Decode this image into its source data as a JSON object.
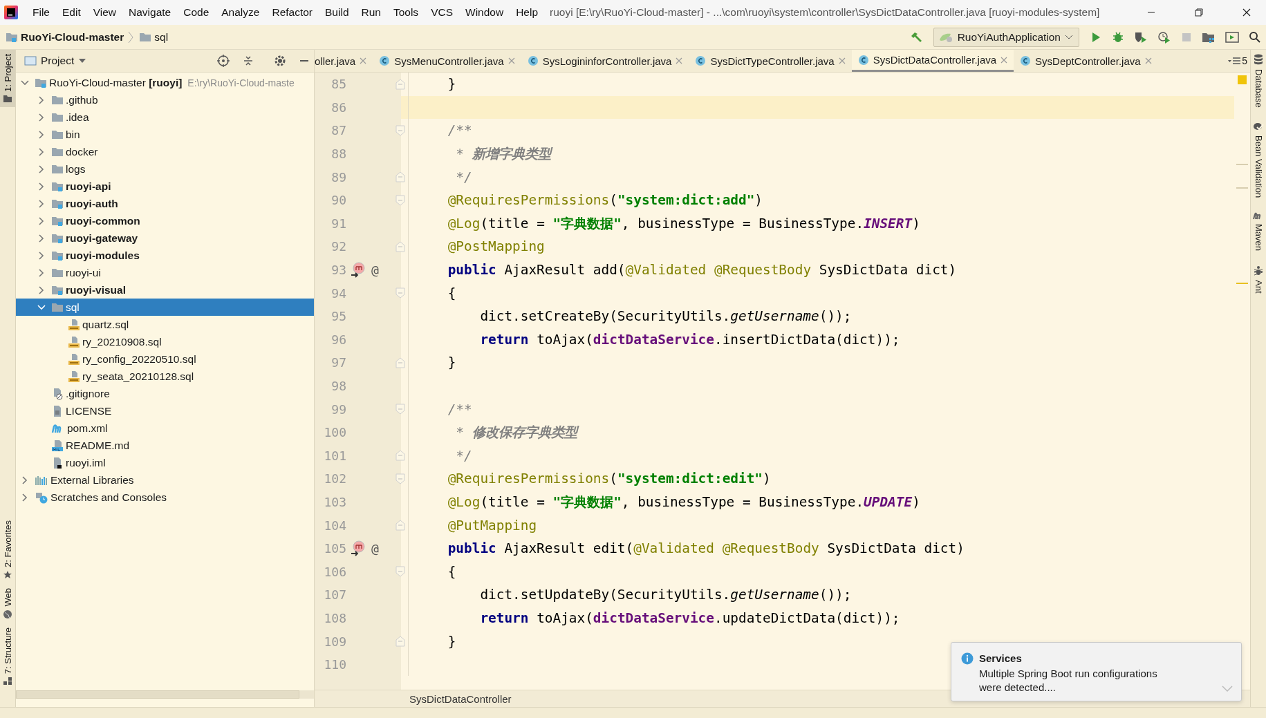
{
  "title_bar": {
    "menu": [
      "File",
      "Edit",
      "View",
      "Navigate",
      "Code",
      "Analyze",
      "Refactor",
      "Build",
      "Run",
      "Tools",
      "VCS",
      "Window",
      "Help"
    ],
    "title": "ruoyi [E:\\ry\\RuoYi-Cloud-master] - ...\\com\\ruoyi\\system\\controller\\SysDictDataController.java [ruoyi-modules-system]"
  },
  "nav_bar": {
    "breadcrumbs": [
      {
        "label": "RuoYi-Cloud-master",
        "kind": "module"
      },
      {
        "label": "sql",
        "kind": "folder"
      }
    ],
    "run_config": "RuoYiAuthApplication"
  },
  "left_strip": [
    {
      "label": "1: Project",
      "selected": true,
      "kind": "folder"
    },
    {
      "label": "2: Favorites",
      "selected": false,
      "kind": "star"
    },
    {
      "label": "Web",
      "selected": false,
      "kind": "globe"
    },
    {
      "label": "7: Structure",
      "selected": false,
      "kind": "structure"
    }
  ],
  "project_panel": {
    "title": "Project",
    "tree": [
      {
        "name": "RuoYi-Cloud-master **[ruoyi]**",
        "path": "E:\\ry\\RuoYi-Cloud-maste",
        "kind": "module",
        "expanded": true,
        "selected": false,
        "bold": false,
        "children": [
          {
            "name": ".github",
            "kind": "folder",
            "expanded": false,
            "selected": false,
            "bold": false
          },
          {
            "name": ".idea",
            "kind": "folder",
            "expanded": false,
            "selected": false,
            "bold": false
          },
          {
            "name": "bin",
            "kind": "folder",
            "expanded": false,
            "selected": false,
            "bold": false
          },
          {
            "name": "docker",
            "kind": "folder",
            "expanded": false,
            "selected": false,
            "bold": false
          },
          {
            "name": "logs",
            "kind": "folder",
            "expanded": false,
            "selected": false,
            "bold": false
          },
          {
            "name": "ruoyi-api",
            "kind": "module",
            "expanded": false,
            "selected": false,
            "bold": true
          },
          {
            "name": "ruoyi-auth",
            "kind": "module",
            "expanded": false,
            "selected": false,
            "bold": true
          },
          {
            "name": "ruoyi-common",
            "kind": "module",
            "expanded": false,
            "selected": false,
            "bold": true
          },
          {
            "name": "ruoyi-gateway",
            "kind": "module",
            "expanded": false,
            "selected": false,
            "bold": true
          },
          {
            "name": "ruoyi-modules",
            "kind": "module",
            "expanded": false,
            "selected": false,
            "bold": true
          },
          {
            "name": "ruoyi-ui",
            "kind": "folder",
            "expanded": false,
            "selected": false,
            "bold": false
          },
          {
            "name": "ruoyi-visual",
            "kind": "module",
            "expanded": false,
            "selected": false,
            "bold": true
          },
          {
            "name": "sql",
            "kind": "folder",
            "expanded": true,
            "selected": true,
            "bold": false,
            "children": [
              {
                "name": "quartz.sql",
                "kind": "sql",
                "selected": false,
                "bold": false
              },
              {
                "name": "ry_20210908.sql",
                "kind": "sql",
                "selected": false,
                "bold": false
              },
              {
                "name": "ry_config_20220510.sql",
                "kind": "sql",
                "selected": false,
                "bold": false
              },
              {
                "name": "ry_seata_20210128.sql",
                "kind": "sql",
                "selected": false,
                "bold": false
              }
            ]
          },
          {
            "name": ".gitignore",
            "kind": "ignore",
            "selected": false,
            "bold": false
          },
          {
            "name": "LICENSE",
            "kind": "text",
            "selected": false,
            "bold": false
          },
          {
            "name": "pom.xml",
            "kind": "maven",
            "selected": false,
            "bold": false
          },
          {
            "name": "README.md",
            "kind": "markdown",
            "selected": false,
            "bold": false
          },
          {
            "name": "ruoyi.iml",
            "kind": "iml",
            "selected": false,
            "bold": false
          }
        ]
      },
      {
        "name": "External Libraries",
        "kind": "libraries",
        "expanded": false,
        "selected": false,
        "bold": false
      },
      {
        "name": "Scratches and Consoles",
        "kind": "scratches",
        "expanded": false,
        "selected": false,
        "bold": false
      }
    ]
  },
  "tabs": [
    {
      "label": "oller.java",
      "kind": "cut",
      "selected": false
    },
    {
      "label": "SysMenuController.java",
      "kind": "class",
      "selected": false
    },
    {
      "label": "SysLogininforController.java",
      "kind": "class",
      "selected": false
    },
    {
      "label": "SysDictTypeController.java",
      "kind": "class",
      "selected": false
    },
    {
      "label": "SysDictDataController.java",
      "kind": "class",
      "selected": true
    },
    {
      "label": "SysDeptController.java",
      "kind": "class",
      "selected": false
    }
  ],
  "hidden_tab_count": "5",
  "editor": {
    "lines": [
      {
        "number": "85",
        "current": false,
        "fold_marker": {
          "kind": "end"
        },
        "tokens": [
          {
            "t": "    }",
            "kind": "plain"
          }
        ]
      },
      {
        "number": "86",
        "current": true
      },
      {
        "number": "87",
        "current": false,
        "fold_marker": {
          "kind": "start"
        },
        "tokens": [
          {
            "t": "    /**",
            "kind": "comment"
          }
        ]
      },
      {
        "number": "88",
        "current": false,
        "tokens": [
          {
            "t": "     * ",
            "kind": "comment"
          },
          {
            "t": "新增字典类型",
            "kind": "doc"
          }
        ]
      },
      {
        "number": "89",
        "current": false,
        "fold_marker": {
          "kind": "end"
        },
        "tokens": [
          {
            "t": "     */",
            "kind": "comment"
          }
        ]
      },
      {
        "number": "90",
        "current": false,
        "fold_marker": {
          "kind": "start"
        },
        "tokens": [
          {
            "t": "    @RequiresPermissions",
            "kind": "annotation"
          },
          {
            "t": "(",
            "kind": "plain"
          },
          {
            "t": "\"system:dict:add\"",
            "kind": "string"
          },
          {
            "t": ")",
            "kind": "plain"
          }
        ]
      },
      {
        "number": "91",
        "current": false,
        "tokens": [
          {
            "t": "    @Log",
            "kind": "annotation"
          },
          {
            "t": "(title = ",
            "kind": "plain"
          },
          {
            "t": "\"字典数据\"",
            "kind": "string"
          },
          {
            "t": ", businessType = BusinessType.",
            "kind": "plain"
          },
          {
            "t": "INSERT",
            "kind": "constant"
          },
          {
            "t": ")",
            "kind": "plain"
          }
        ]
      },
      {
        "number": "92",
        "current": false,
        "fold_marker": {
          "kind": "end"
        },
        "tokens": [
          {
            "t": "    @PostMapping",
            "kind": "annotation"
          }
        ]
      },
      {
        "number": "93",
        "current": false,
        "gutter": {
          "kind": "method",
          "symbol": "@"
        },
        "tokens": [
          {
            "t": "    public",
            "kind": "keyword"
          },
          {
            "t": " AjaxResult add(",
            "kind": "plain"
          },
          {
            "t": "@Validated @RequestBody",
            "kind": "annotation"
          },
          {
            "t": " SysDictData dict)",
            "kind": "plain"
          }
        ]
      },
      {
        "number": "94",
        "current": false,
        "fold_marker": {
          "kind": "start"
        },
        "tokens": [
          {
            "t": "    {",
            "kind": "plain"
          }
        ]
      },
      {
        "number": "95",
        "current": false,
        "tokens": [
          {
            "t": "        dict.setCreateBy(SecurityUtils.",
            "kind": "plain"
          },
          {
            "t": "getUsername",
            "kind": "static"
          },
          {
            "t": "());",
            "kind": "plain"
          }
        ]
      },
      {
        "number": "96",
        "current": false,
        "tokens": [
          {
            "t": "        return",
            "kind": "keyword"
          },
          {
            "t": " toAjax(",
            "kind": "plain"
          },
          {
            "t": "dictDataService",
            "kind": "field"
          },
          {
            "t": ".insertDictData(dict));",
            "kind": "plain"
          }
        ]
      },
      {
        "number": "97",
        "current": false,
        "fold_marker": {
          "kind": "end"
        },
        "tokens": [
          {
            "t": "    }",
            "kind": "plain"
          }
        ]
      },
      {
        "number": "98",
        "current": false
      },
      {
        "number": "99",
        "current": false,
        "fold_marker": {
          "kind": "start"
        },
        "tokens": [
          {
            "t": "    /**",
            "kind": "comment"
          }
        ]
      },
      {
        "number": "100",
        "current": false,
        "tokens": [
          {
            "t": "     * ",
            "kind": "comment"
          },
          {
            "t": "修改保存字典类型",
            "kind": "doc"
          }
        ]
      },
      {
        "number": "101",
        "current": false,
        "fold_marker": {
          "kind": "end"
        },
        "tokens": [
          {
            "t": "     */",
            "kind": "comment"
          }
        ]
      },
      {
        "number": "102",
        "current": false,
        "fold_marker": {
          "kind": "start"
        },
        "tokens": [
          {
            "t": "    @RequiresPermissions",
            "kind": "annotation"
          },
          {
            "t": "(",
            "kind": "plain"
          },
          {
            "t": "\"system:dict:edit\"",
            "kind": "string"
          },
          {
            "t": ")",
            "kind": "plain"
          }
        ]
      },
      {
        "number": "103",
        "current": false,
        "tokens": [
          {
            "t": "    @Log",
            "kind": "annotation"
          },
          {
            "t": "(title = ",
            "kind": "plain"
          },
          {
            "t": "\"字典数据\"",
            "kind": "string"
          },
          {
            "t": ", businessType = BusinessType.",
            "kind": "plain"
          },
          {
            "t": "UPDATE",
            "kind": "constant"
          },
          {
            "t": ")",
            "kind": "plain"
          }
        ]
      },
      {
        "number": "104",
        "current": false,
        "fold_marker": {
          "kind": "end"
        },
        "tokens": [
          {
            "t": "    @PutMapping",
            "kind": "annotation"
          }
        ]
      },
      {
        "number": "105",
        "current": false,
        "gutter": {
          "kind": "method",
          "symbol": "@"
        },
        "tokens": [
          {
            "t": "    public",
            "kind": "keyword"
          },
          {
            "t": " AjaxResult edit(",
            "kind": "plain"
          },
          {
            "t": "@Validated @RequestBody",
            "kind": "annotation"
          },
          {
            "t": " SysDictData dict)",
            "kind": "plain"
          }
        ]
      },
      {
        "number": "106",
        "current": false,
        "fold_marker": {
          "kind": "start"
        },
        "tokens": [
          {
            "t": "    {",
            "kind": "plain"
          }
        ]
      },
      {
        "number": "107",
        "current": false,
        "tokens": [
          {
            "t": "        dict.setUpdateBy(SecurityUtils.",
            "kind": "plain"
          },
          {
            "t": "getUsername",
            "kind": "static"
          },
          {
            "t": "());",
            "kind": "plain"
          }
        ]
      },
      {
        "number": "108",
        "current": false,
        "tokens": [
          {
            "t": "        return",
            "kind": "keyword"
          },
          {
            "t": " toAjax(",
            "kind": "plain"
          },
          {
            "t": "dictDataService",
            "kind": "field"
          },
          {
            "t": ".updateDictData(dict));",
            "kind": "plain"
          }
        ]
      },
      {
        "number": "109",
        "current": false,
        "fold_marker": {
          "kind": "end"
        },
        "tokens": [
          {
            "t": "    }",
            "kind": "plain"
          }
        ]
      },
      {
        "number": "110",
        "current": false
      }
    ],
    "breadcrumb": "SysDictDataController"
  },
  "right_strip": [
    {
      "label": "Database",
      "kind": "database"
    },
    {
      "label": "Bean Validation",
      "kind": "bean"
    },
    {
      "label": "Maven",
      "kind": "maven"
    },
    {
      "label": "Ant",
      "kind": "ant"
    }
  ],
  "notification": {
    "title": "Services",
    "message": "Multiple Spring Boot run configurations were detected...."
  }
}
